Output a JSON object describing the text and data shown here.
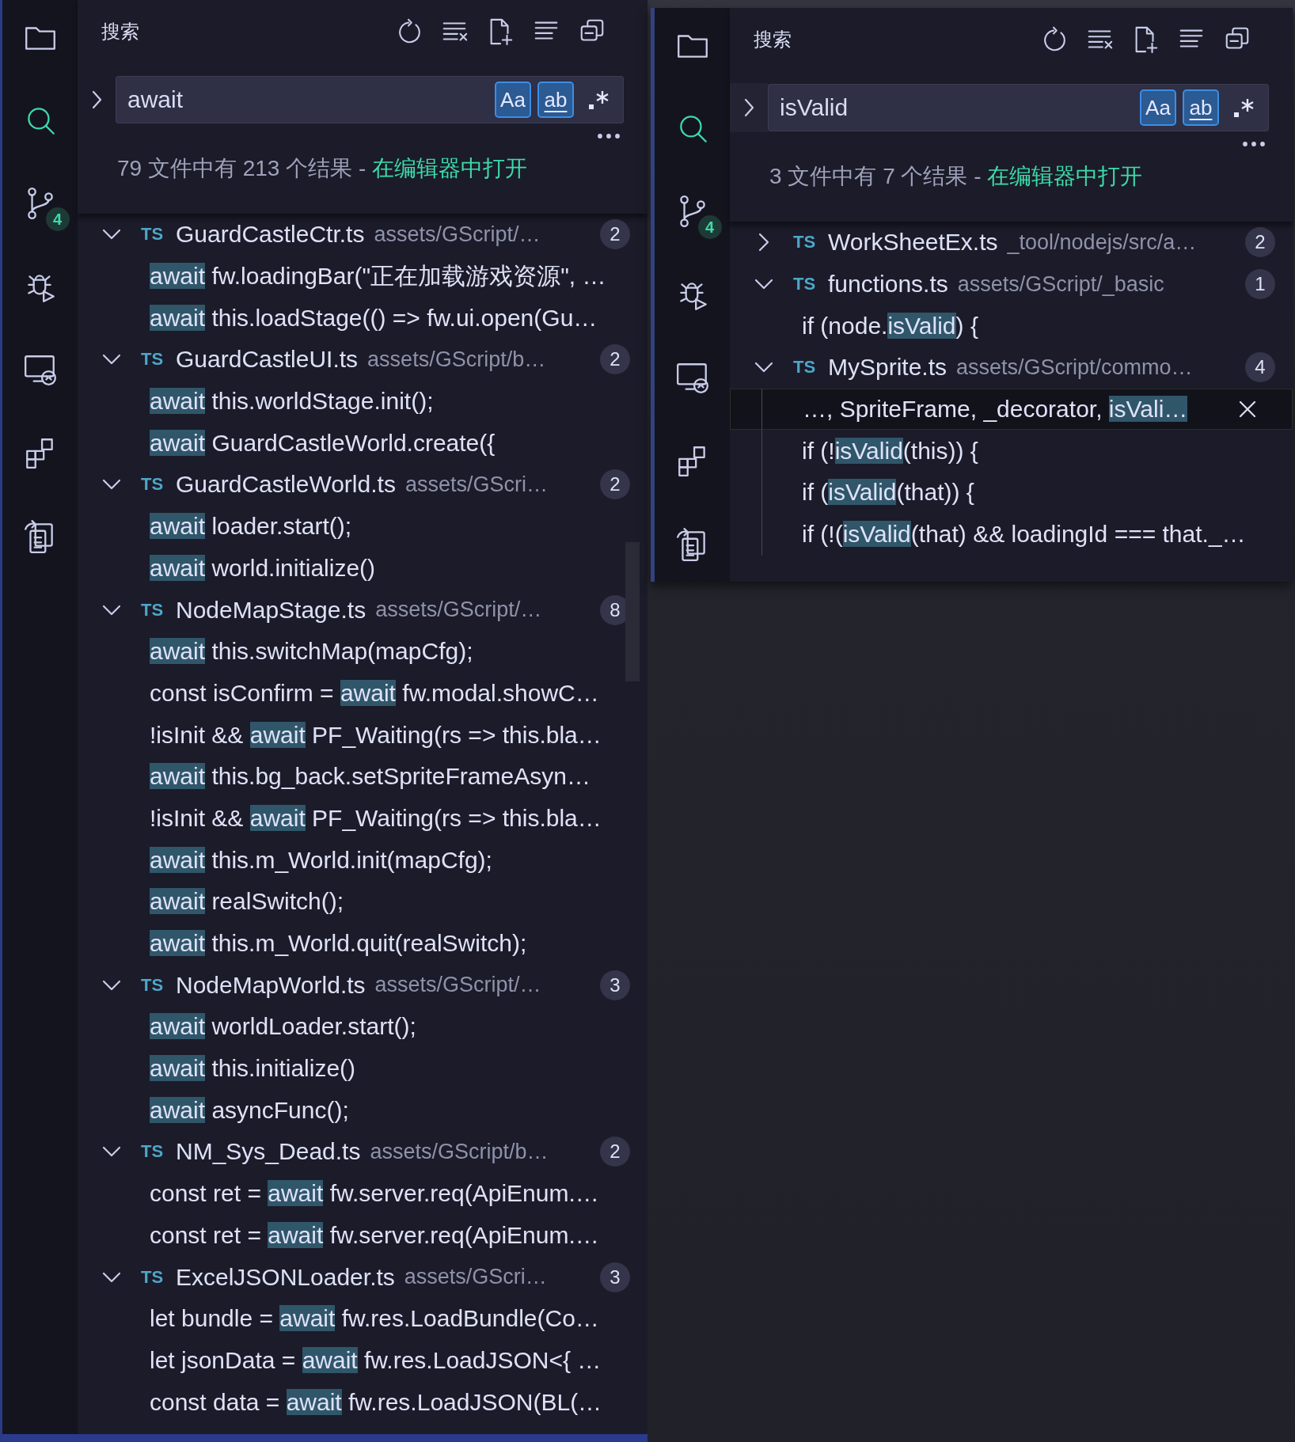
{
  "panels": [
    {
      "activity_bar": [
        {
          "kind": "explorer",
          "selected": false
        },
        {
          "kind": "search",
          "selected": true
        },
        {
          "kind": "source-control",
          "selected": false,
          "badge": "4"
        },
        {
          "kind": "debug",
          "selected": false
        },
        {
          "kind": "remote",
          "selected": false
        },
        {
          "kind": "extensions",
          "selected": false
        },
        {
          "kind": "documents",
          "selected": false
        }
      ],
      "title": "搜索",
      "replace_expanded": false,
      "query": "await",
      "toggles": [
        {
          "kind": "case",
          "label": "Aa",
          "on": true
        },
        {
          "kind": "word",
          "label": "ab",
          "on": true
        },
        {
          "kind": "regex",
          "on": false
        }
      ],
      "summary": "79 文件中有 213 个结果 - ",
      "open_link": "在编辑器中打开",
      "results": [
        {
          "lang": "TS",
          "name": "GuardCastleCtr.ts",
          "path": "assets/GScript/…",
          "count": "2",
          "expanded": true,
          "matches": [
            {
              "match": "await",
              "after": " fw.loadingBar(\"正在加载游戏资源\", …",
              "selected": false
            },
            {
              "match": "await",
              "after": " this.loadStage(() => fw.ui.open(Gu…",
              "selected": false
            }
          ]
        },
        {
          "lang": "TS",
          "name": "GuardCastleUI.ts",
          "path": "assets/GScript/b…",
          "count": "2",
          "expanded": true,
          "matches": [
            {
              "match": "await",
              "after": " this.worldStage.init();",
              "selected": false
            },
            {
              "match": "await",
              "after": " GuardCastleWorld.create({",
              "selected": false
            }
          ]
        },
        {
          "lang": "TS",
          "name": "GuardCastleWorld.ts",
          "path": "assets/GScri…",
          "count": "2",
          "expanded": true,
          "matches": [
            {
              "match": "await",
              "after": " loader.start();",
              "selected": false
            },
            {
              "match": "await",
              "after": " world.initialize()",
              "selected": false
            }
          ]
        },
        {
          "lang": "TS",
          "name": "NodeMapStage.ts",
          "path": "assets/GScript/…",
          "count": "8",
          "expanded": true,
          "matches": [
            {
              "match": "await",
              "after": " this.switchMap(mapCfg);",
              "selected": false
            },
            {
              "before": "const isConfirm = ",
              "match": "await",
              "after": " fw.modal.showC…",
              "selected": false
            },
            {
              "before": "!isInit && ",
              "match": "await",
              "after": " PF_Waiting(rs => this.bla…",
              "selected": false
            },
            {
              "match": "await",
              "after": " this.bg_back.setSpriteFrameAsyn…",
              "selected": false
            },
            {
              "before": "!isInit && ",
              "match": "await",
              "after": " PF_Waiting(rs => this.bla…",
              "selected": false
            },
            {
              "match": "await",
              "after": " this.m_World.init(mapCfg);",
              "selected": false
            },
            {
              "match": "await",
              "after": " realSwitch();",
              "selected": false
            },
            {
              "match": "await",
              "after": " this.m_World.quit(realSwitch);",
              "selected": false
            }
          ]
        },
        {
          "lang": "TS",
          "name": "NodeMapWorld.ts",
          "path": "assets/GScript/…",
          "count": "3",
          "expanded": true,
          "matches": [
            {
              "match": "await",
              "after": " worldLoader.start();",
              "selected": false
            },
            {
              "match": "await",
              "after": " this.initialize()",
              "selected": false
            },
            {
              "match": "await",
              "after": " asyncFunc();",
              "selected": false
            }
          ]
        },
        {
          "lang": "TS",
          "name": "NM_Sys_Dead.ts",
          "path": "assets/GScript/b…",
          "count": "2",
          "expanded": true,
          "matches": [
            {
              "before": "const ret = ",
              "match": "await",
              "after": " fw.server.req(ApiEnum.…",
              "selected": false
            },
            {
              "before": "const ret = ",
              "match": "await",
              "after": " fw.server.req(ApiEnum.…",
              "selected": false
            }
          ]
        },
        {
          "lang": "TS",
          "name": "ExcelJSONLoader.ts",
          "path": "assets/GScri…",
          "count": "3",
          "expanded": true,
          "matches": [
            {
              "before": "let bundle = ",
              "match": "await",
              "after": " fw.res.LoadBundle(Co…",
              "selected": false
            },
            {
              "before": "let jsonData = ",
              "match": "await",
              "after": " fw.res.LoadJSON<{ …",
              "selected": false
            },
            {
              "before": "const data = ",
              "match": "await",
              "after": " fw.res.LoadJSON(BL(…",
              "selected": false
            }
          ]
        }
      ]
    },
    {
      "activity_bar": [
        {
          "kind": "explorer",
          "selected": false
        },
        {
          "kind": "search",
          "selected": true
        },
        {
          "kind": "source-control",
          "selected": false,
          "badge": "4"
        },
        {
          "kind": "debug",
          "selected": false
        },
        {
          "kind": "remote",
          "selected": false
        },
        {
          "kind": "extensions",
          "selected": false
        },
        {
          "kind": "documents",
          "selected": false
        }
      ],
      "title": "搜索",
      "replace_expanded": false,
      "query": "isValid",
      "toggles": [
        {
          "kind": "case",
          "label": "Aa",
          "on": true
        },
        {
          "kind": "word",
          "label": "ab",
          "on": true
        },
        {
          "kind": "regex",
          "on": false
        }
      ],
      "summary": "3 文件中有 7 个结果 - ",
      "open_link": "在编辑器中打开",
      "results": [
        {
          "lang": "TS",
          "name": "WorkSheetEx.ts",
          "path": "_tool/nodejs/src/a…",
          "count": "2",
          "expanded": false
        },
        {
          "lang": "TS",
          "name": "functions.ts",
          "path": "assets/GScript/_basic",
          "count": "1",
          "expanded": true,
          "matches": [
            {
              "before": "if (node.",
              "match": "isValid",
              "after": ") {",
              "selected": false
            }
          ]
        },
        {
          "lang": "TS",
          "name": "MySprite.ts",
          "path": "assets/GScript/commo…",
          "count": "4",
          "expanded": true,
          "matches": [
            {
              "before": "…, SpriteFrame, _decorator, ",
              "match": "isVali…",
              "selected": true
            },
            {
              "before": "if (!",
              "match": "isValid",
              "after": "(this)) {",
              "selected": false
            },
            {
              "before": "if (",
              "match": "isValid",
              "after": "(that)) {",
              "selected": false
            },
            {
              "before": "if (!(",
              "match": "isValid",
              "after": "(that) && loadingId === that._…",
              "selected": false
            }
          ]
        }
      ]
    }
  ]
}
